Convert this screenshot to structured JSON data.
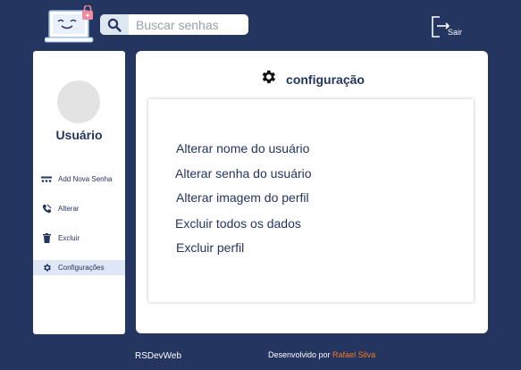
{
  "header": {
    "search_placeholder": "Buscar senhas",
    "logout_label": "Sair"
  },
  "sidebar": {
    "username": "Usuário",
    "items": [
      {
        "label": "Add Nova Senha",
        "icon": "key-dots-icon"
      },
      {
        "label": "Alterar",
        "icon": "edit-phone-icon"
      },
      {
        "label": "Excluir",
        "icon": "trash-icon"
      },
      {
        "label": "Configurações",
        "icon": "gear-icon",
        "active": true
      }
    ]
  },
  "main": {
    "title": "configuração",
    "options": [
      "Alterar nome do usuário",
      "Alterar senha do usuário",
      "Alterar imagem do perfil",
      "Excluir todos os dados",
      "Excluir perfil"
    ]
  },
  "footer": {
    "brand": "RSDevWeb",
    "credit_prefix": "Desenvolvido por ",
    "author": "Rafael Silva"
  },
  "colors": {
    "background": "#24355f",
    "accent": "#f47a1f",
    "active_nav": "#dfe7f6"
  }
}
